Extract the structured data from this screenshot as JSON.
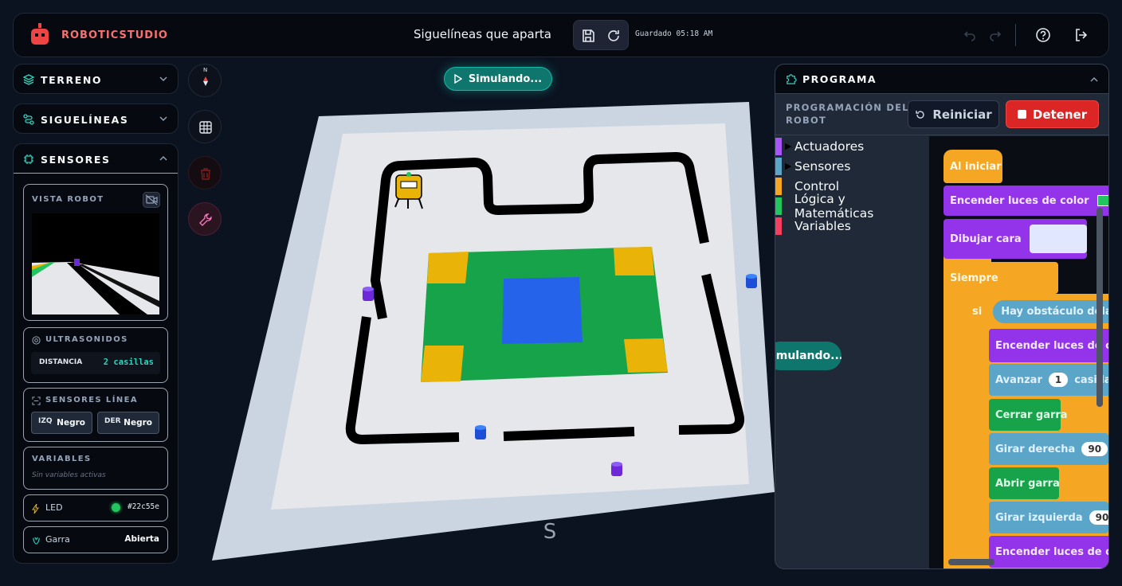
{
  "header": {
    "brand": "ROBOTICSTUDIO",
    "project_title": "Siguelíneas que aparta todo",
    "saved_status": "Guardado 05:18 AM"
  },
  "left_panels": {
    "terreno": "TERRENO",
    "siguelineas": "SIGUELÍNEAS",
    "sensores": "SENSORES"
  },
  "sensors": {
    "robot_view_label": "VISTA ROBOT",
    "ultrasonic_label": "ULTRASONIDOS",
    "distance_label": "DISTANCIA",
    "distance_value": "2 casillas",
    "line_label": "SENSORES LÍNEA",
    "left_short": "IZQ",
    "left_value": "Negro",
    "right_short": "DER",
    "right_value": "Negro",
    "variables_label": "VARIABLES",
    "variables_empty": "Sin variables activas",
    "led_label": "LED",
    "led_color": "#22c55e",
    "led_value": "#22c55e",
    "claw_label": "Garra",
    "claw_value": "Abierta"
  },
  "simulation": {
    "status_button": "Simulando...",
    "compass_north": "N",
    "compass_south": "S",
    "track_color": "#000000",
    "mat_green": "#16a34a",
    "mat_blue": "#2563eb",
    "mat_yellow": "#eab308"
  },
  "program": {
    "title": "PROGRAMA",
    "subtitle": "PROGRAMACIÓN DEL ROBOT",
    "reset_button": "Reiniciar",
    "stop_button": "Detener",
    "categories": [
      {
        "label": "Actuadores",
        "color": "#a855f7"
      },
      {
        "label": "Sensores",
        "color": "#5ba5c9"
      },
      {
        "label": "Control",
        "color": "#f5a623"
      },
      {
        "label": "Lógica y Matemáticas",
        "color": "#22c55e"
      },
      {
        "label": "Variables",
        "color": "#f43f5e"
      }
    ],
    "blocks": {
      "on_start": "Al iniciar",
      "lights": "Encender luces de color",
      "draw_face": "Dibujar cara",
      "forever": "Siempre",
      "if": "si",
      "obstacle": "Hay obstáculo delante",
      "lights2": "Encender luces de color",
      "advance": "Avanzar",
      "advance_value": "1",
      "advance_unit": "casillas",
      "close_claw": "Cerrar garra",
      "turn_right": "Girar derecha",
      "turn_right_value": "90",
      "open_claw": "Abrir garra",
      "turn_left": "Girar izquierda",
      "turn_left_value": "90",
      "lights3": "Encender luces de color",
      "sim_badge": "Simulando..."
    }
  }
}
